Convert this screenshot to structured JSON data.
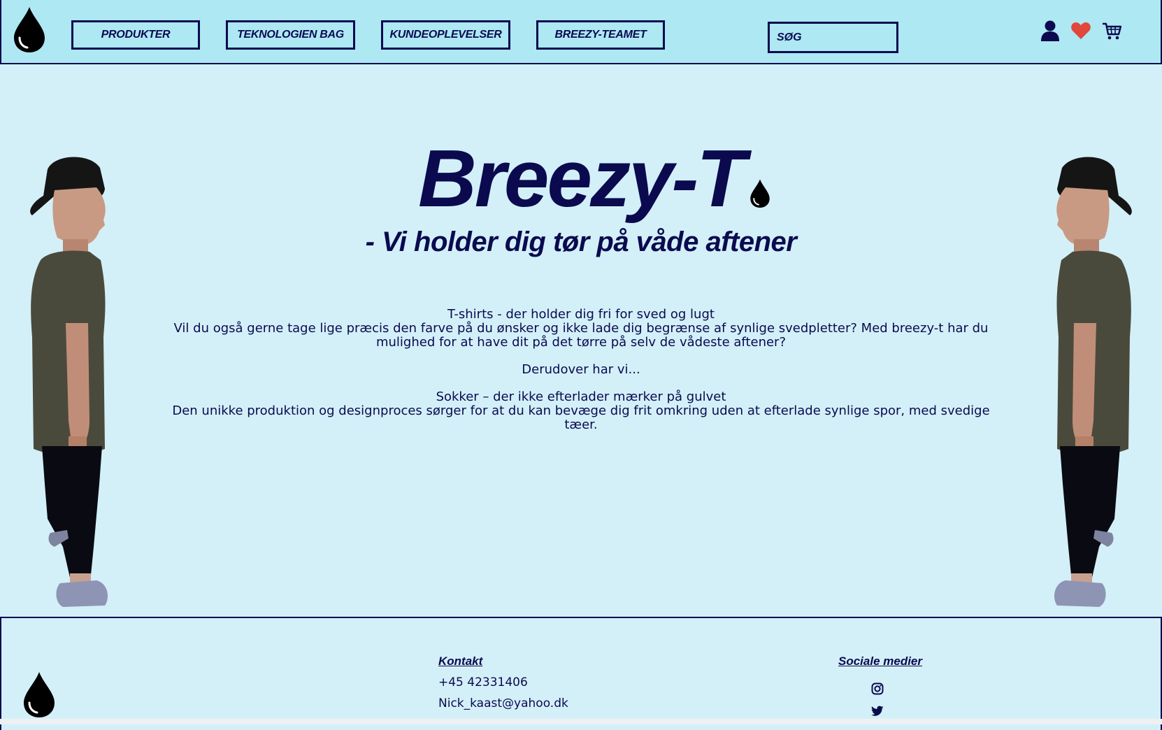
{
  "nav": {
    "items": [
      {
        "label": "PRODUKTER"
      },
      {
        "label": "TEKNOLOGIEN BAG"
      },
      {
        "label": "KUNDEOPLEVELSER"
      },
      {
        "label": "BREEZY-TEAMET"
      }
    ],
    "search_placeholder": "SØG",
    "icons": [
      "user-icon",
      "heart-icon",
      "cart-icon"
    ]
  },
  "hero": {
    "title": "Breezy-T",
    "subtitle": "- Vi holder dig tør på våde aftener"
  },
  "content": {
    "line1": "T-shirts - der holder dig fri for sved og lugt",
    "line2": "Vil du også gerne tage lige præcis den farve på du ønsker og ikke lade dig begrænse af synlige svedpletter? Med breezy-t har du mulighed for at have dit på det tørre på selv de vådeste aftener?",
    "line3": "Derudover har vi...",
    "line4": "Sokker – der ikke efterlader mærker på gulvet",
    "line5": "Den unikke produktion og designproces sørger for at du kan bevæge dig frit omkring uden at efterlade synlige spor, med svedige tæer."
  },
  "footer": {
    "contact_heading": "Kontakt",
    "phone": "+45 42331406",
    "email": "Nick_kaast@yahoo.dk",
    "social_heading": "Sociale medier",
    "social_icons": [
      "instagram-icon",
      "twitter-icon"
    ]
  },
  "colors": {
    "nav_bg": "#ade8f3",
    "page_bg": "#d3f0f8",
    "navy": "#0b0a4f",
    "heart": "#e2473c"
  }
}
